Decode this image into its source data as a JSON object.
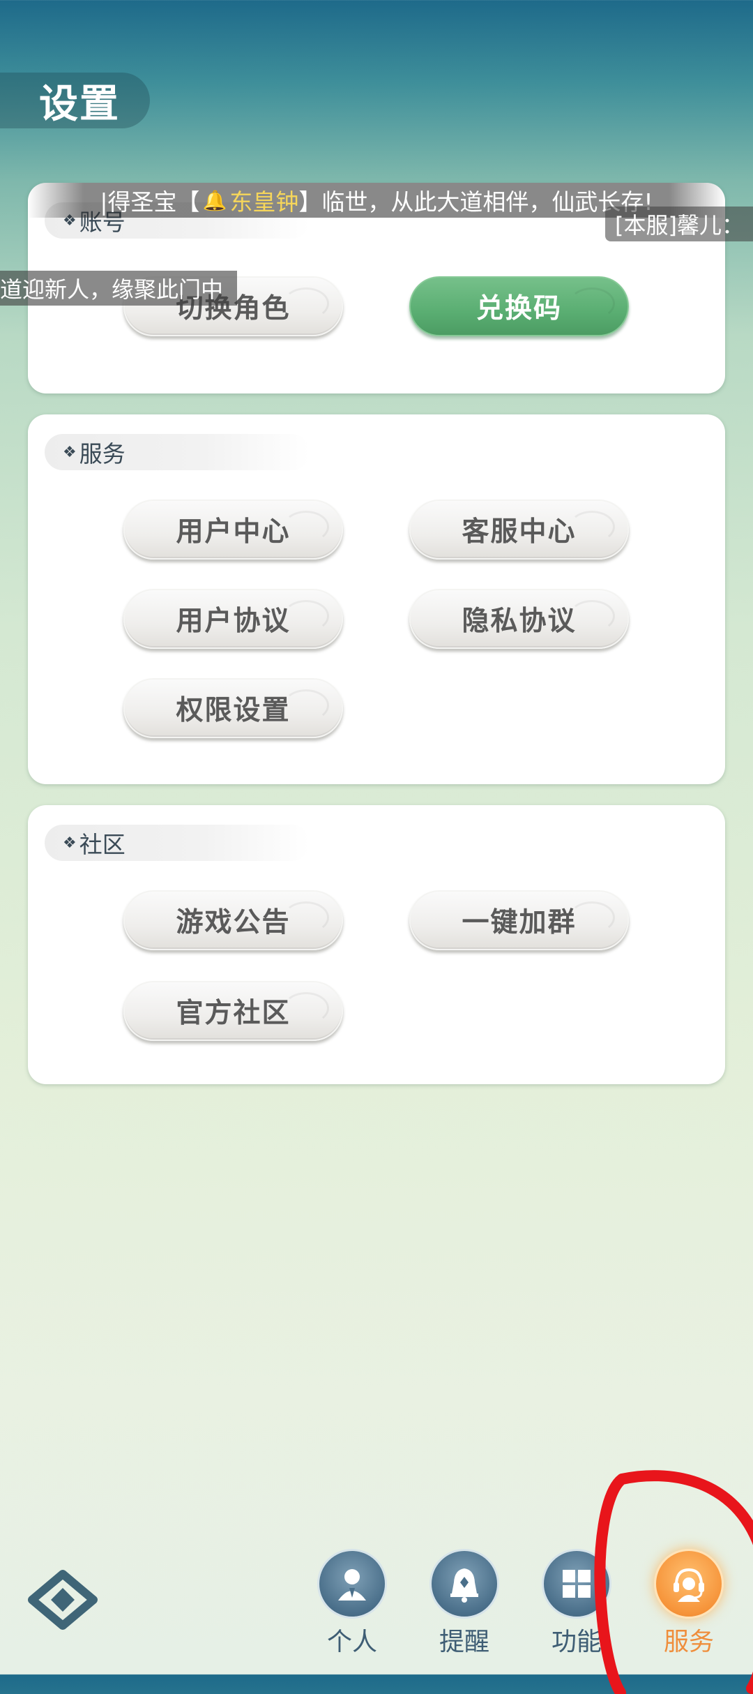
{
  "page": {
    "title": "设置"
  },
  "marquee": {
    "main_prefix": "|得圣宝【",
    "main_highlight": "东皇钟",
    "main_suffix": "】临世，从此大道相伴，仙武长存!",
    "right": "[本服]馨儿：",
    "left": "道迎新人，缘聚此门中"
  },
  "account": {
    "header": "账号",
    "buttons": [
      {
        "label": "切换角色"
      },
      {
        "label": "兑换码"
      }
    ]
  },
  "service": {
    "header": "服务",
    "buttons": [
      {
        "label": "用户中心"
      },
      {
        "label": "客服中心"
      },
      {
        "label": "用户协议"
      },
      {
        "label": "隐私协议"
      },
      {
        "label": "权限设置"
      }
    ]
  },
  "community": {
    "header": "社区",
    "buttons": [
      {
        "label": "游戏公告"
      },
      {
        "label": "一键加群"
      },
      {
        "label": "官方社区"
      }
    ]
  },
  "nav": {
    "items": [
      {
        "label": "个人",
        "icon": "person-icon"
      },
      {
        "label": "提醒",
        "icon": "bell-icon"
      },
      {
        "label": "功能",
        "icon": "grid-icon"
      },
      {
        "label": "服务",
        "icon": "headset-icon"
      }
    ],
    "active": "服务"
  },
  "colors": {
    "accent_green": "#5aae72",
    "active_orange": "#f6943a",
    "nav_blue": "#4a6f8a",
    "annotation_red": "#e8151b"
  }
}
